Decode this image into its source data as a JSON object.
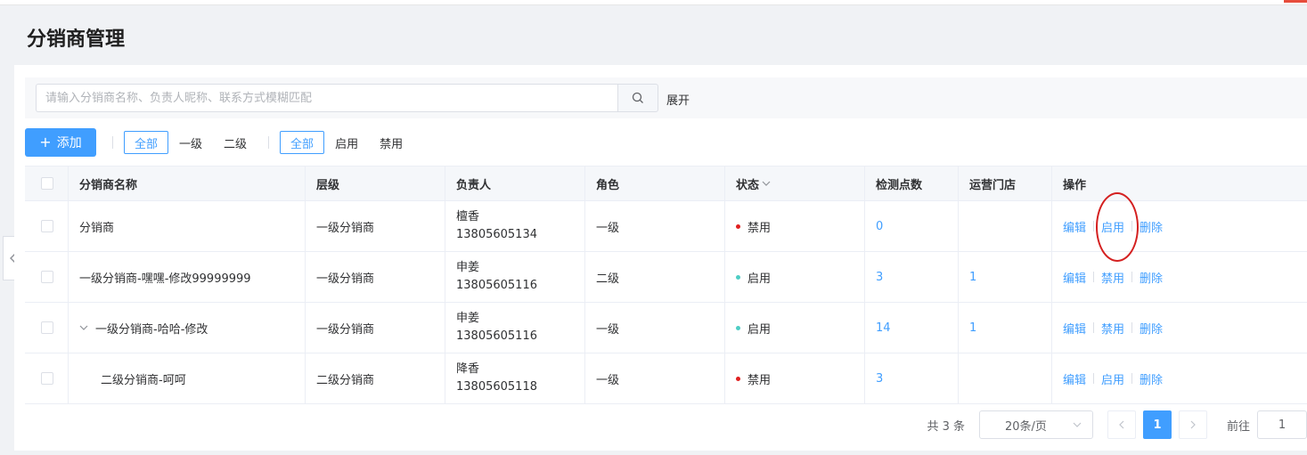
{
  "page": {
    "title": "分销商管理"
  },
  "search": {
    "placeholder": "请输入分销商名称、负责人昵称、联系方式模糊匹配",
    "value": "",
    "expand_label": "展开"
  },
  "toolbar": {
    "add_label": "添加",
    "level_filters": [
      "全部",
      "一级",
      "二级"
    ],
    "status_filters": [
      "全部",
      "启用",
      "禁用"
    ]
  },
  "table": {
    "columns": [
      "分销商名称",
      "层级",
      "负责人",
      "角色",
      "状态",
      "检测点数",
      "运营门店",
      "操作"
    ],
    "rows": [
      {
        "name": "分销商",
        "level": "一级分销商",
        "owner": "檀香",
        "phone": "13805605134",
        "role": "一级",
        "status": "禁用",
        "points": "0",
        "stores": "",
        "op_toggle": "启用"
      },
      {
        "name": "一级分销商-嘿嘿-修改99999999",
        "level": "一级分销商",
        "owner": "申姜",
        "phone": "13805605116",
        "role": "二级",
        "status": "启用",
        "points": "3",
        "stores": "1",
        "op_toggle": "禁用"
      },
      {
        "name": "一级分销商-哈哈-修改",
        "level": "一级分销商",
        "owner": "申姜",
        "phone": "13805605116",
        "role": "一级",
        "status": "启用",
        "points": "14",
        "stores": "1",
        "op_toggle": "禁用"
      },
      {
        "name": "二级分销商-呵呵",
        "level": "二级分销商",
        "owner": "降香",
        "phone": "13805605118",
        "role": "一级",
        "status": "禁用",
        "points": "3",
        "stores": "",
        "op_toggle": "启用"
      }
    ],
    "op_edit": "编辑",
    "op_delete": "删除"
  },
  "pagination": {
    "total_text": "共 3 条",
    "page_size": "20条/页",
    "current_page": "1",
    "goto_label": "前往",
    "goto_value": "1"
  },
  "colors": {
    "primary": "#409eff",
    "disabled_dot": "#e02020",
    "enabled_dot": "#4ecdc4"
  }
}
